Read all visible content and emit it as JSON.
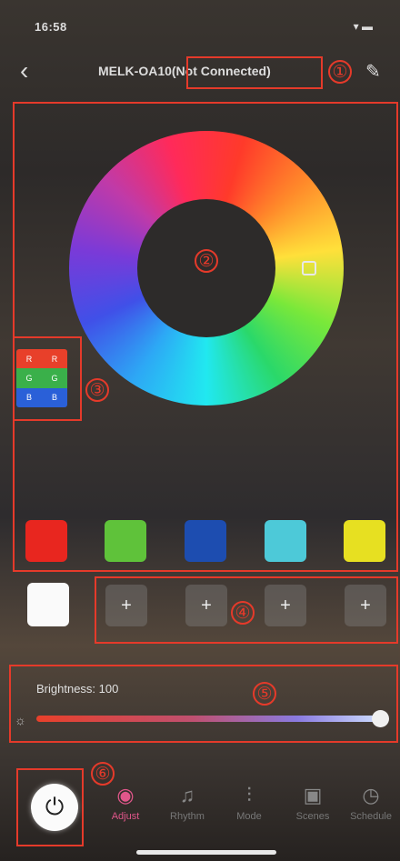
{
  "status_bar": {
    "time": "16:58",
    "icons": "▾ ▬"
  },
  "header": {
    "back": "‹",
    "title": "MELK-OA10(Not Connected)",
    "edit": "✎"
  },
  "annotations": [
    "①",
    "②",
    "③",
    "④",
    "⑤",
    "⑥"
  ],
  "mode_icon": {
    "rows": [
      {
        "color": "#e8402a",
        "label": "R"
      },
      {
        "color": "#3ab04a",
        "label": "G"
      },
      {
        "color": "#2a60d8",
        "label": "B"
      }
    ]
  },
  "swatches": [
    {
      "color": "#e8261f"
    },
    {
      "color": "#5fc23a"
    },
    {
      "color": "#1d4db0"
    },
    {
      "color": "#4dc9d8"
    },
    {
      "color": "#e7e021"
    }
  ],
  "custom_slots": {
    "plus": "+"
  },
  "brightness": {
    "label": "Brightness: 100",
    "value": 100,
    "max": 100
  },
  "tabs": [
    {
      "label": "Adjust",
      "icon": "palette-icon",
      "glyph": "◉",
      "active": true
    },
    {
      "label": "Rhythm",
      "icon": "music-note-icon",
      "glyph": "♫",
      "active": false
    },
    {
      "label": "Mode",
      "icon": "sliders-icon",
      "glyph": "⫶",
      "active": false
    },
    {
      "label": "Scenes",
      "icon": "image-icon",
      "glyph": "▣",
      "active": false
    },
    {
      "label": "Schedule",
      "icon": "clock-icon",
      "glyph": "◷",
      "active": false
    }
  ],
  "power": {
    "glyph": "⏻"
  }
}
